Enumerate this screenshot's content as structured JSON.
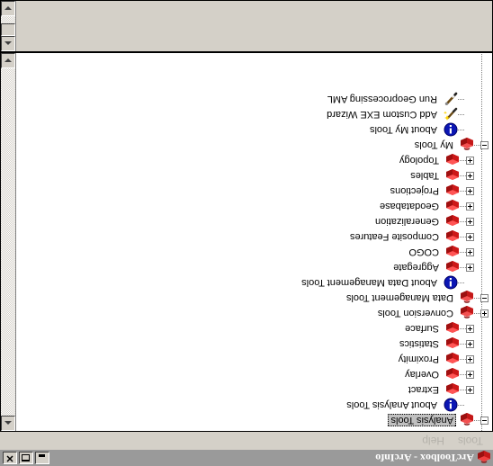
{
  "window": {
    "title": "ArcToolbox - ArcInfo",
    "app_icon": "toolbox-icon",
    "controls": {
      "minimize_label": "",
      "minimize_icon": "minimize-icon",
      "maximize_label": "",
      "maximize_icon": "maximize-icon",
      "close_label": "✕",
      "close_icon": "close-icon"
    }
  },
  "menu": {
    "items": [
      {
        "label": "Tools",
        "name": "menu-tools"
      },
      {
        "label": "Help",
        "name": "menu-help"
      }
    ]
  },
  "tree": {
    "selected": "Analysis Tools",
    "nodes": [
      {
        "label": "Analysis Tools",
        "level": 0,
        "expander": "minus",
        "icon": "toolbox-icon",
        "selected": true
      },
      {
        "label": "About Analysis Tools",
        "level": 1,
        "expander": "none",
        "icon": "info-icon",
        "selected": false
      },
      {
        "label": "Extract",
        "level": 1,
        "expander": "plus",
        "icon": "toolset-icon",
        "selected": false
      },
      {
        "label": "Overlay",
        "level": 1,
        "expander": "plus",
        "icon": "toolset-icon",
        "selected": false
      },
      {
        "label": "Proximity",
        "level": 1,
        "expander": "plus",
        "icon": "toolset-icon",
        "selected": false
      },
      {
        "label": "Statistics",
        "level": 1,
        "expander": "plus",
        "icon": "toolset-icon",
        "selected": false
      },
      {
        "label": "Surface",
        "level": 1,
        "expander": "plus",
        "icon": "toolset-icon",
        "selected": false
      },
      {
        "label": "Conversion Tools",
        "level": 0,
        "expander": "plus",
        "icon": "toolbox-icon",
        "selected": false
      },
      {
        "label": "Data Management Tools",
        "level": 0,
        "expander": "minus",
        "icon": "toolbox-icon",
        "selected": false
      },
      {
        "label": "About Data Management Tools",
        "level": 1,
        "expander": "none",
        "icon": "info-icon",
        "selected": false
      },
      {
        "label": "Aggregate",
        "level": 1,
        "expander": "plus",
        "icon": "toolset-icon",
        "selected": false
      },
      {
        "label": "COGO",
        "level": 1,
        "expander": "plus",
        "icon": "toolset-icon",
        "selected": false
      },
      {
        "label": "Composite Features",
        "level": 1,
        "expander": "plus",
        "icon": "toolset-icon",
        "selected": false
      },
      {
        "label": "Generalization",
        "level": 1,
        "expander": "plus",
        "icon": "toolset-icon",
        "selected": false
      },
      {
        "label": "Geodatabase",
        "level": 1,
        "expander": "plus",
        "icon": "toolset-icon",
        "selected": false
      },
      {
        "label": "Projections",
        "level": 1,
        "expander": "plus",
        "icon": "toolset-icon",
        "selected": false
      },
      {
        "label": "Tables",
        "level": 1,
        "expander": "plus",
        "icon": "toolset-icon",
        "selected": false
      },
      {
        "label": "Topology",
        "level": 1,
        "expander": "plus",
        "icon": "toolset-icon",
        "selected": false
      },
      {
        "label": "My Tools",
        "level": 0,
        "expander": "minus",
        "icon": "toolbox-icon",
        "selected": false
      },
      {
        "label": "About My Tools",
        "level": 1,
        "expander": "none",
        "icon": "info-icon",
        "selected": false
      },
      {
        "label": "Add Custom EXE Wizard",
        "level": 1,
        "expander": "none",
        "icon": "wand-icon",
        "selected": false
      },
      {
        "label": "Run Geoprocessing AML",
        "level": 1,
        "expander": "none",
        "icon": "pen-icon",
        "selected": false
      }
    ]
  },
  "scrollbar": {
    "up_icon": "scroll-up-arrow-icon",
    "down_icon": "scroll-down-arrow-icon"
  },
  "colors": {
    "toolbox_red": "#d81e1e",
    "toolbox_dark_red": "#a00000",
    "info_blue": "#0000c8",
    "window_face": "#d4d0c8",
    "title_bar": "#9a9a9a",
    "selection": "#c0c0c0"
  }
}
